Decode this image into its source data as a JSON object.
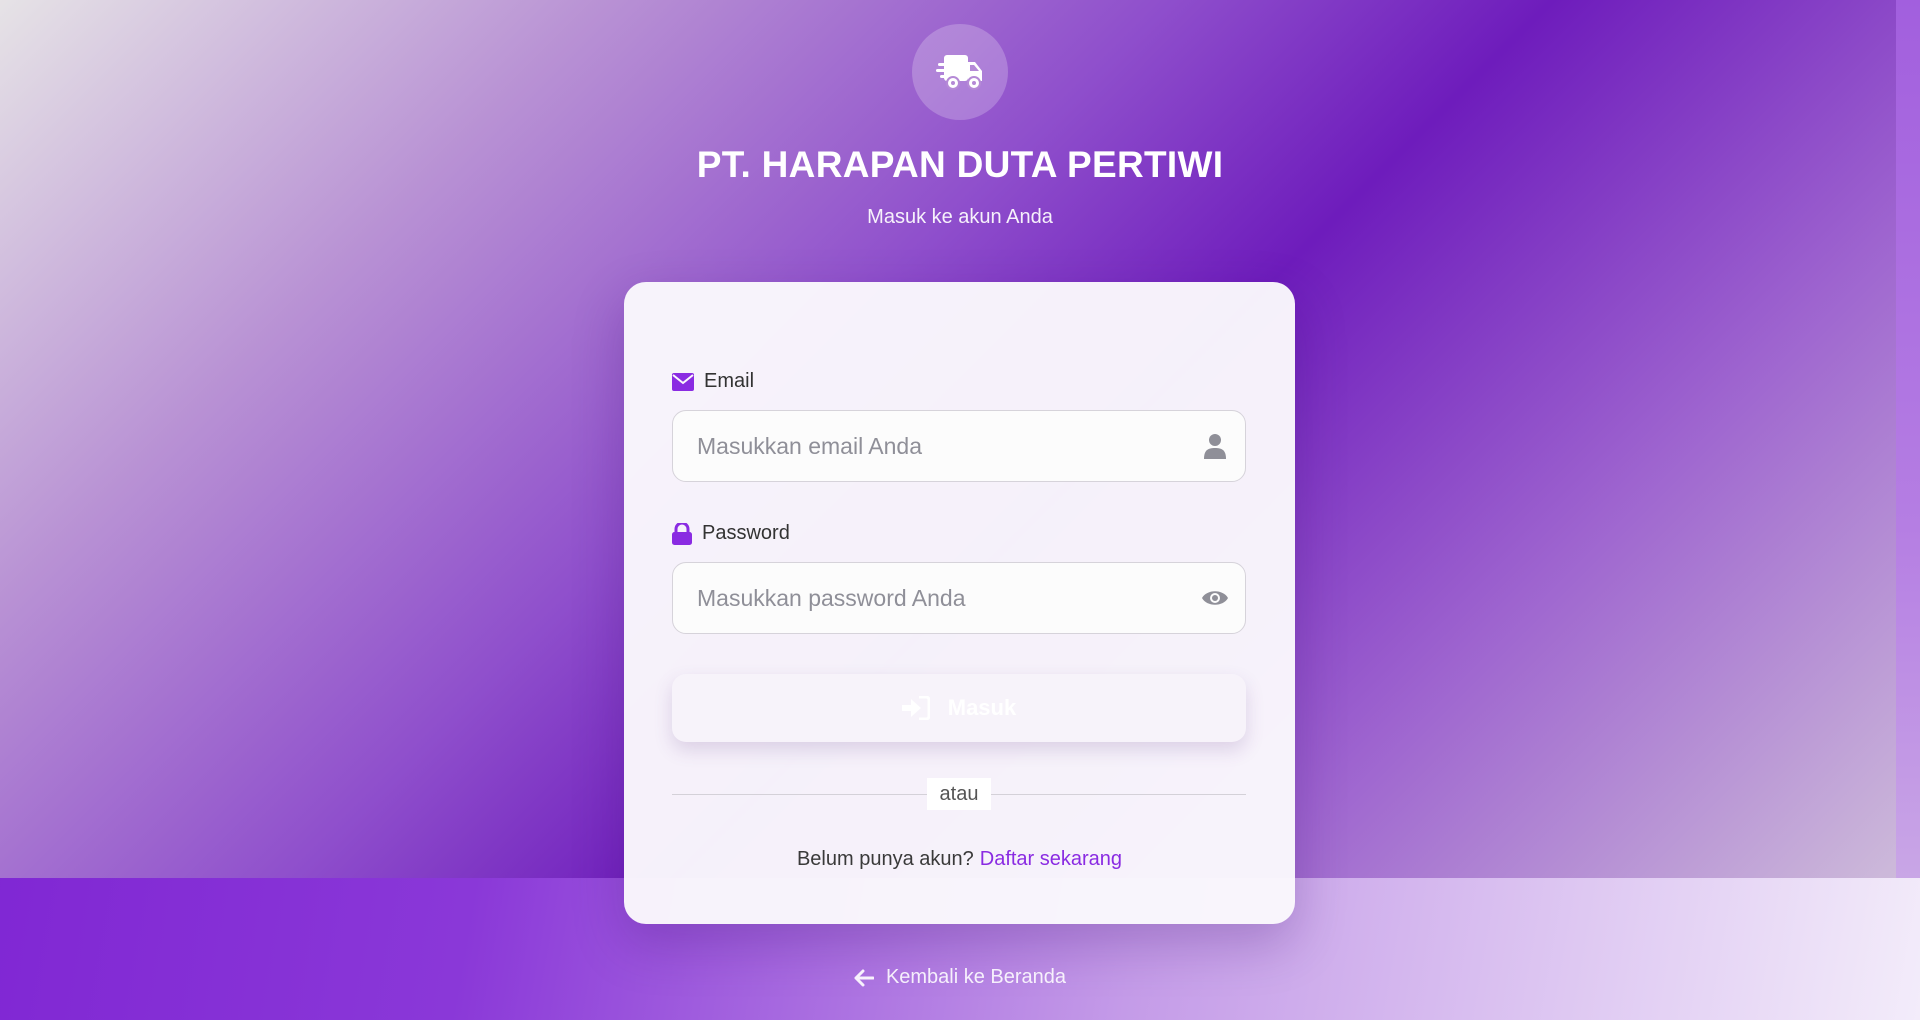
{
  "brand": {
    "title": "PT. HARAPAN DUTA PERTIWI",
    "subtitle": "Masuk ke akun Anda",
    "logo_icon": "truck-fast-icon"
  },
  "form": {
    "email": {
      "label": "Email",
      "label_icon": "envelope-icon",
      "placeholder": "Masukkan email Anda",
      "value": "",
      "trailing_icon": "user-icon"
    },
    "password": {
      "label": "Password",
      "label_icon": "lock-icon",
      "placeholder": "Masukkan password Anda",
      "value": "",
      "trailing_icon": "eye-icon"
    },
    "submit_label": "Masuk",
    "submit_icon": "sign-in-icon"
  },
  "divider": {
    "text": "atau"
  },
  "signup": {
    "prompt": "Belum punya akun?",
    "link_label": "Daftar sekarang"
  },
  "back": {
    "label": "Kembali ke Beranda",
    "icon": "arrow-left-icon"
  },
  "colors": {
    "accent": "#8a2be2",
    "background_dark": "#6e1cbc",
    "card": "#faf8fc",
    "icon_gray": "#8f8f98"
  }
}
